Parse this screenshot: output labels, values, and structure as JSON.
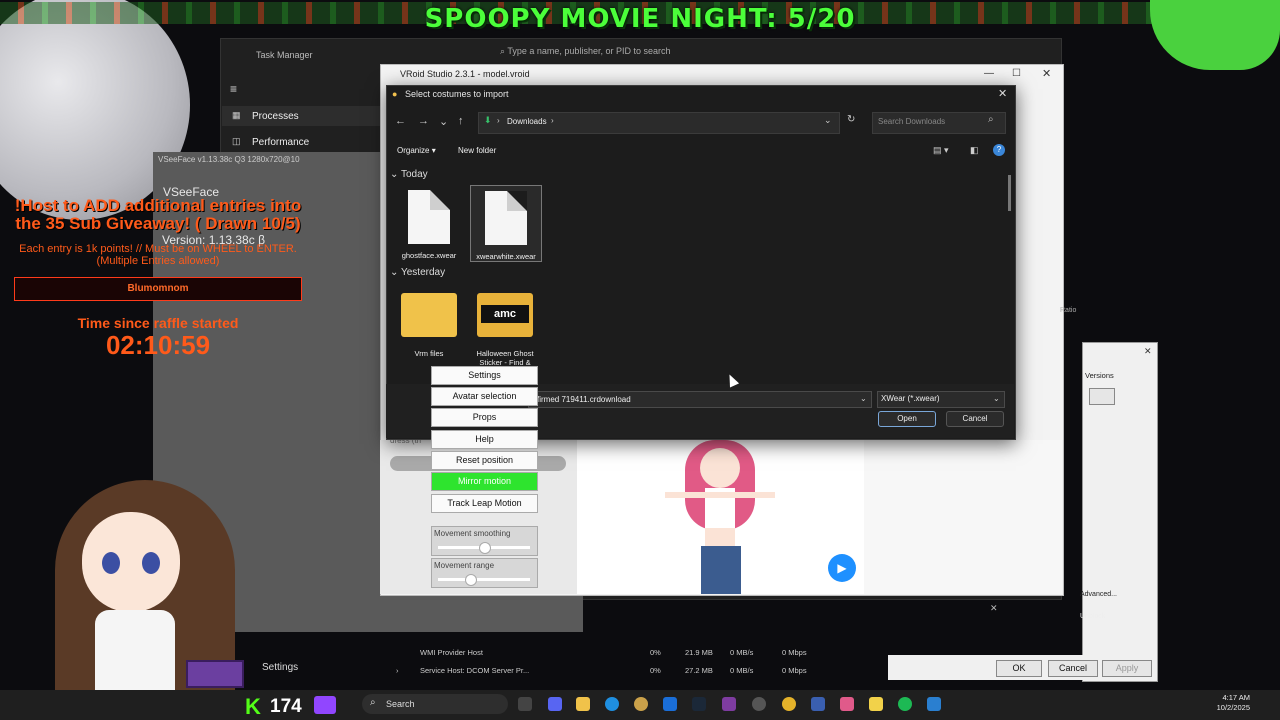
{
  "overlay": {
    "banner": "SPOOPY MOVIE NIGHT: 5/20",
    "giveaway_title": "!Host to ADD additional entries into the 35 Sub Giveaway! ( Drawn 10/5)",
    "giveaway_sub": "Each entry is 1k points! // Must be on WHEEL to ENTER. (Multiple Entries allowed)",
    "raffle_name": "Blumomnom",
    "time_label": "Time since raffle started",
    "timer": "02:10:59",
    "kick_count": "174"
  },
  "task_manager": {
    "title": "Task Manager",
    "search_placeholder": "Type a name, publisher, or PID to search",
    "sidebar": [
      {
        "label": "Processes"
      },
      {
        "label": "Performance"
      }
    ],
    "rows": [
      {
        "name": "WMI Provider Host",
        "cpu": "0%",
        "mem": "21.9 MB",
        "disk": "0 MB/s",
        "net": "0 Mbps"
      },
      {
        "name": "Service Host: DCOM Server Pr...",
        "cpu": "0%",
        "mem": "27.2 MB",
        "disk": "0 MB/s",
        "net": "0 Mbps"
      }
    ]
  },
  "vseeface": {
    "title": "VSeeFace v1.13.38c Q3 1280x720@10",
    "name": "VSeeFace",
    "version": "Version: 1.13.38c β",
    "menu": [
      "Settings",
      "Avatar selection",
      "Props",
      "Help",
      "Reset position",
      "Mirror motion",
      "Track Leap Motion"
    ],
    "sliders": [
      {
        "label": "Movement smoothing",
        "value": 0.5
      },
      {
        "label": "Movement range",
        "value": 0.35
      }
    ],
    "settings_label": "Settings"
  },
  "vroid": {
    "title": "VRoid Studio 2.3.1 - model.vroid",
    "dress_label": "dress (th"
  },
  "file_dialog": {
    "title": "Select costumes to import",
    "path": "Downloads",
    "search_placeholder": "Search Downloads",
    "organize": "Organize",
    "new_folder": "New folder",
    "groups": [
      {
        "label": "Today",
        "items": [
          {
            "name": "ghostface.xwear",
            "type": "file"
          },
          {
            "name": "xwearwhite.xwear",
            "type": "file"
          }
        ]
      },
      {
        "label": "Yesterday",
        "items": [
          {
            "name": "Vrm files",
            "type": "folder"
          },
          {
            "name": "Halloween Ghost Sticker - Find &",
            "type": "folder-amc"
          }
        ]
      }
    ],
    "amc_label": "amc",
    "filename": "firmed 719411.crdownload",
    "filter": "XWear (*.xwear)",
    "open": "Open",
    "cancel": "Cancel"
  },
  "properties_dialog": {
    "versions": "Versions",
    "ok": "OK",
    "cancel": "Cancel",
    "apply": "Apply",
    "advanced": "Advanced...",
    "unblock": "Unblock",
    "ratio": "Ratio"
  },
  "taskbar": {
    "search": "Search",
    "time": "4:17 AM",
    "date": "10/2/2025"
  }
}
